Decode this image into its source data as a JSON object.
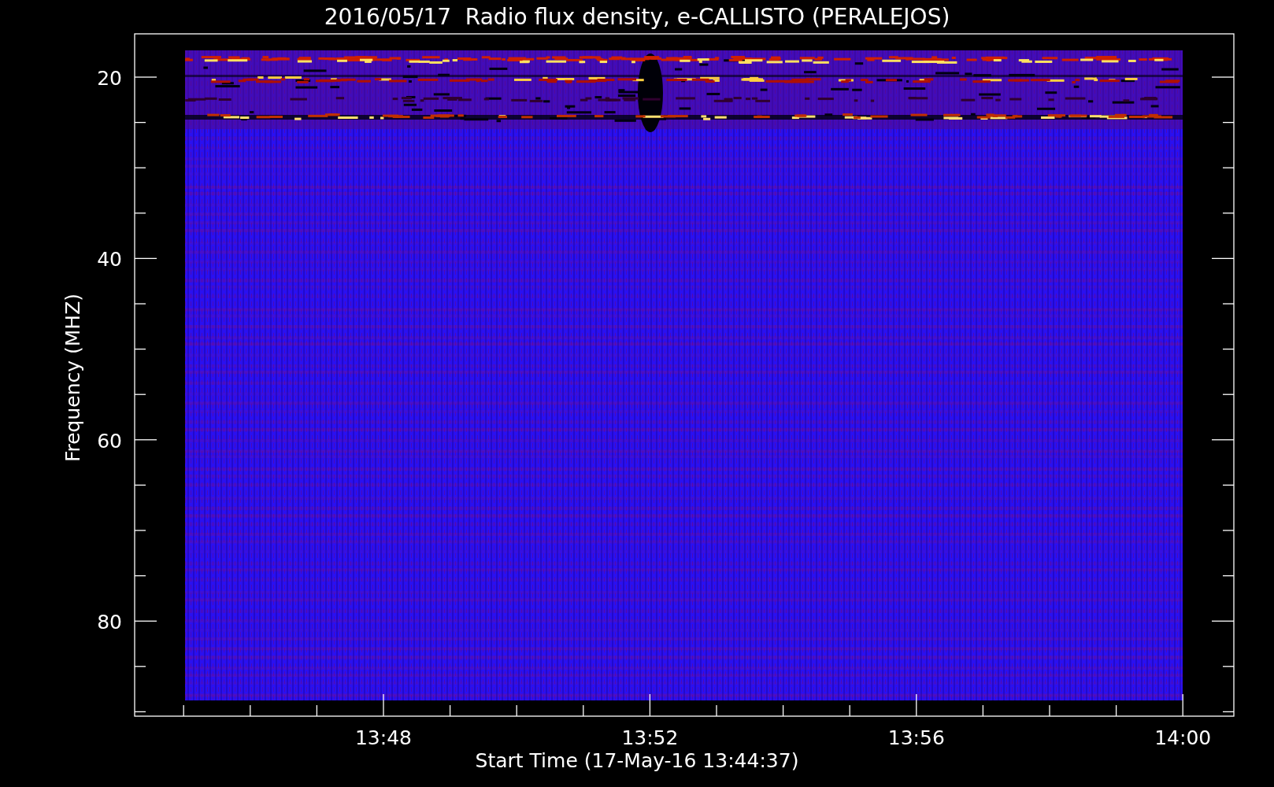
{
  "title": "2016/05/17  Radio flux density, e-CALLISTO (PERALEJOS)",
  "y_axis": {
    "label": "Frequency (MHZ)",
    "ticks": [
      "20",
      "40",
      "60",
      "80"
    ]
  },
  "x_axis": {
    "label": "Start Time (17-May-16 13:44:37)",
    "ticks": [
      "13:48",
      "13:52",
      "13:56",
      "14:00"
    ]
  }
}
